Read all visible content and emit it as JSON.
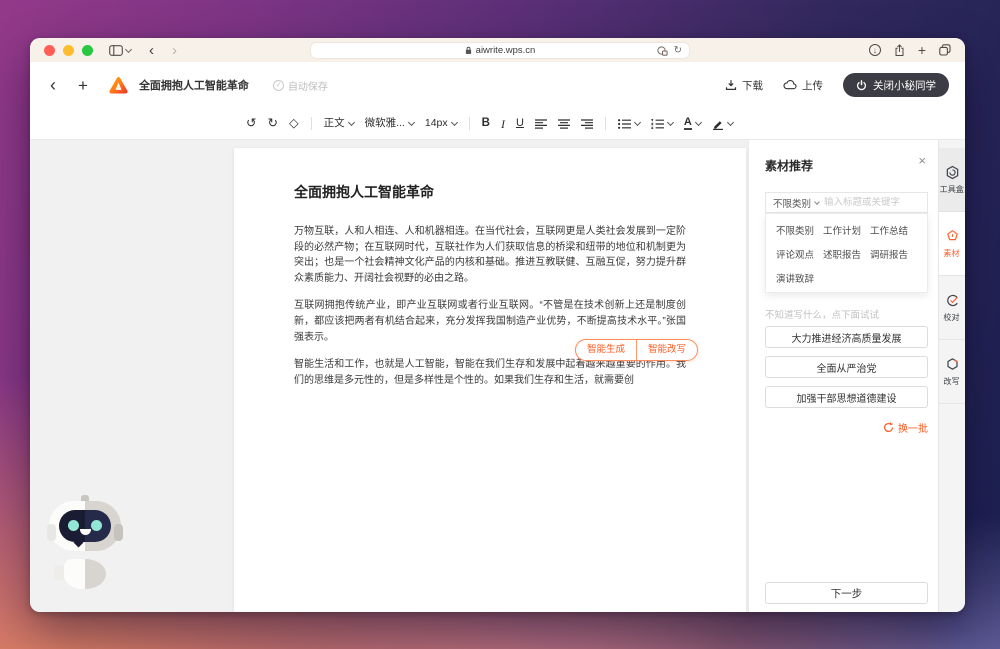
{
  "icons": {
    "back": "‹",
    "forward": "›",
    "plus": "+",
    "undo": "↺",
    "redo": "↻",
    "reload": "↻",
    "clear_format": "◇",
    "close": "×",
    "check": "✓",
    "down_arrow": "↓"
  },
  "browser": {
    "url": "aiwrite.wps.cn"
  },
  "app_header": {
    "doc_title": "全面拥抱人工智能革命",
    "autosave_label": "自动保存",
    "download_label": "下载",
    "upload_label": "上传",
    "close_assistant_label": "关闭小秘同学"
  },
  "editor_toolbar": {
    "paragraph_style": "正文",
    "font_name": "微软雅...",
    "font_size": "14px",
    "bold": "B",
    "italic": "I",
    "underline": "U",
    "font_color": "A"
  },
  "document": {
    "title": "全面拥抱人工智能革命",
    "paragraphs": [
      "万物互联，人和人相连、人和机器相连。在当代社会，互联网更是人类社会发展到一定阶段的必然产物；在互联网时代，互联社作为人们获取信息的桥梁和纽带的地位和机制更为突出；也是一个社会精神文化产品的内核和基础。推进互教联健、互融互促，努力提升群众素质能力、开阔社会视野的必由之路。",
      "互联网拥抱传统产业，即产业互联网或者行业互联网。“不管是在技术创新上还是制度创新，都应该把两者有机结合起来，充分发挥我国制造产业优势，不断提高技术水平。”张国强表示。",
      "智能生活和工作，也就是人工智能，智能在我们生存和发展中起着越来越重要的作用。我们的思维是多元性的，但是多样性是个性的。如果我们生存和生活，就需要创"
    ],
    "inline_actions": [
      "智能生成",
      "智能改写"
    ]
  },
  "materials_panel": {
    "title": "素材推荐",
    "filter_label": "不限类别",
    "search_placeholder": "输入标题或关键字",
    "categories": [
      "不限类别",
      "工作计划",
      "工作总结",
      "评论观点",
      "述职报告",
      "调研报告",
      "演讲致辞"
    ],
    "hint": "不知道写什么，点下面试试",
    "suggestions": [
      "大力推进经济高质量发展",
      "全面从严治党",
      "加强干部思想道德建设"
    ],
    "refresh_label": "换一批",
    "next_label": "下一步"
  },
  "side_rail": {
    "tabs": [
      {
        "label": "工具盒"
      },
      {
        "label": "素材"
      },
      {
        "label": "校对"
      },
      {
        "label": "改写"
      }
    ]
  },
  "colors": {
    "accent": "#ff6230",
    "dark_button": "#3c3c44",
    "chrome_bg": "#f7f1e9"
  }
}
